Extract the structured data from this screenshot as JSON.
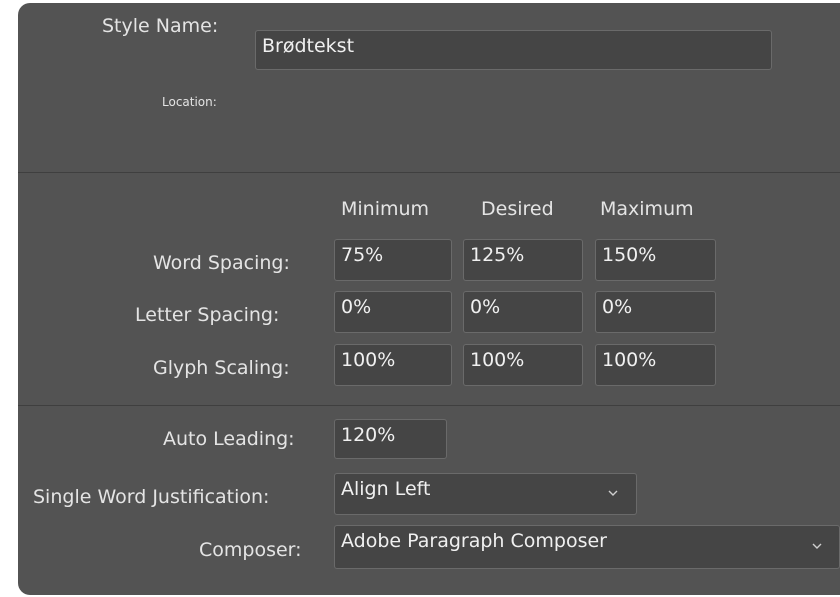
{
  "style": {
    "name_label": "Style Name:",
    "name_value": "Brødtekst",
    "location_label": "Location:"
  },
  "spacing": {
    "col_minimum": "Minimum",
    "col_desired": "Desired",
    "col_maximum": "Maximum",
    "word_spacing_label": "Word Spacing:",
    "word_spacing": [
      "75%",
      "125%",
      "150%"
    ],
    "letter_spacing_label": "Letter Spacing:",
    "letter_spacing": [
      "0%",
      "0%",
      "0%"
    ],
    "glyph_scaling_label": "Glyph Scaling:",
    "glyph_scaling": [
      "100%",
      "100%",
      "100%"
    ]
  },
  "options": {
    "auto_leading_label": "Auto Leading:",
    "auto_leading": "120%",
    "single_word_label": "Single Word Justification:",
    "single_word_value": "Align Left",
    "composer_label": "Composer:",
    "composer_value": "Adobe Paragraph Composer"
  },
  "icons": {
    "dropdown": "chevron-down-icon"
  },
  "colors": {
    "panel_bg": "#535353",
    "field_bg": "#454545",
    "field_border": "#6a6a6a",
    "text": "#e4e4e4"
  }
}
